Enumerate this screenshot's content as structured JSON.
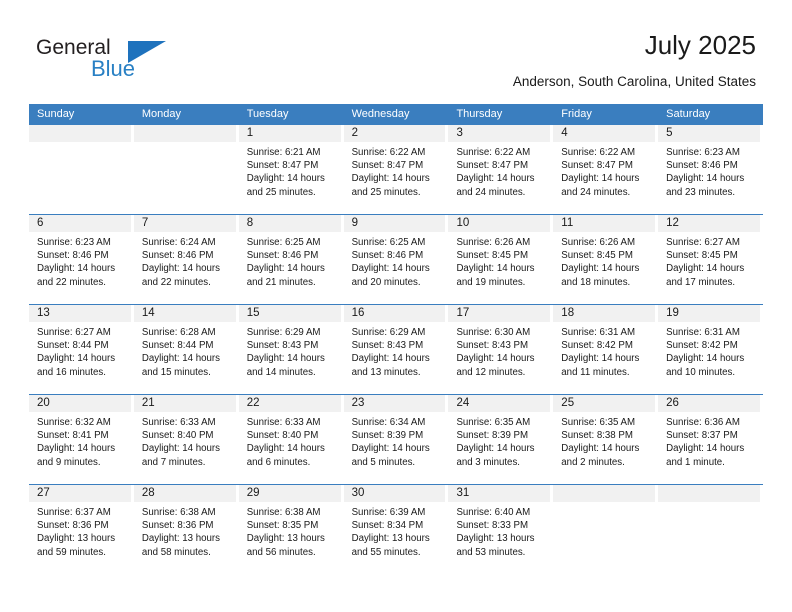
{
  "brand": {
    "name_top": "General",
    "name_bottom": "Blue",
    "triangle_color": "#1e72bd",
    "blue_text_color": "#2980c4"
  },
  "header": {
    "title": "July 2025",
    "location": "Anderson, South Carolina, United States"
  },
  "theme": {
    "header_bg": "#3a7ebf",
    "header_text": "#ffffff",
    "daynum_band": "#f1f1f1",
    "row_divider": "#3a7ebf",
    "body_text": "#1a1a1a"
  },
  "calendar": {
    "weekday_headers": [
      "Sunday",
      "Monday",
      "Tuesday",
      "Wednesday",
      "Thursday",
      "Friday",
      "Saturday"
    ],
    "weeks": [
      [
        {
          "day": ""
        },
        {
          "day": ""
        },
        {
          "day": "1",
          "sunrise": "Sunrise: 6:21 AM",
          "sunset": "Sunset: 8:47 PM",
          "daylight": "Daylight: 14 hours and 25 minutes."
        },
        {
          "day": "2",
          "sunrise": "Sunrise: 6:22 AM",
          "sunset": "Sunset: 8:47 PM",
          "daylight": "Daylight: 14 hours and 25 minutes."
        },
        {
          "day": "3",
          "sunrise": "Sunrise: 6:22 AM",
          "sunset": "Sunset: 8:47 PM",
          "daylight": "Daylight: 14 hours and 24 minutes."
        },
        {
          "day": "4",
          "sunrise": "Sunrise: 6:22 AM",
          "sunset": "Sunset: 8:47 PM",
          "daylight": "Daylight: 14 hours and 24 minutes."
        },
        {
          "day": "5",
          "sunrise": "Sunrise: 6:23 AM",
          "sunset": "Sunset: 8:46 PM",
          "daylight": "Daylight: 14 hours and 23 minutes."
        }
      ],
      [
        {
          "day": "6",
          "sunrise": "Sunrise: 6:23 AM",
          "sunset": "Sunset: 8:46 PM",
          "daylight": "Daylight: 14 hours and 22 minutes."
        },
        {
          "day": "7",
          "sunrise": "Sunrise: 6:24 AM",
          "sunset": "Sunset: 8:46 PM",
          "daylight": "Daylight: 14 hours and 22 minutes."
        },
        {
          "day": "8",
          "sunrise": "Sunrise: 6:25 AM",
          "sunset": "Sunset: 8:46 PM",
          "daylight": "Daylight: 14 hours and 21 minutes."
        },
        {
          "day": "9",
          "sunrise": "Sunrise: 6:25 AM",
          "sunset": "Sunset: 8:46 PM",
          "daylight": "Daylight: 14 hours and 20 minutes."
        },
        {
          "day": "10",
          "sunrise": "Sunrise: 6:26 AM",
          "sunset": "Sunset: 8:45 PM",
          "daylight": "Daylight: 14 hours and 19 minutes."
        },
        {
          "day": "11",
          "sunrise": "Sunrise: 6:26 AM",
          "sunset": "Sunset: 8:45 PM",
          "daylight": "Daylight: 14 hours and 18 minutes."
        },
        {
          "day": "12",
          "sunrise": "Sunrise: 6:27 AM",
          "sunset": "Sunset: 8:45 PM",
          "daylight": "Daylight: 14 hours and 17 minutes."
        }
      ],
      [
        {
          "day": "13",
          "sunrise": "Sunrise: 6:27 AM",
          "sunset": "Sunset: 8:44 PM",
          "daylight": "Daylight: 14 hours and 16 minutes."
        },
        {
          "day": "14",
          "sunrise": "Sunrise: 6:28 AM",
          "sunset": "Sunset: 8:44 PM",
          "daylight": "Daylight: 14 hours and 15 minutes."
        },
        {
          "day": "15",
          "sunrise": "Sunrise: 6:29 AM",
          "sunset": "Sunset: 8:43 PM",
          "daylight": "Daylight: 14 hours and 14 minutes."
        },
        {
          "day": "16",
          "sunrise": "Sunrise: 6:29 AM",
          "sunset": "Sunset: 8:43 PM",
          "daylight": "Daylight: 14 hours and 13 minutes."
        },
        {
          "day": "17",
          "sunrise": "Sunrise: 6:30 AM",
          "sunset": "Sunset: 8:43 PM",
          "daylight": "Daylight: 14 hours and 12 minutes."
        },
        {
          "day": "18",
          "sunrise": "Sunrise: 6:31 AM",
          "sunset": "Sunset: 8:42 PM",
          "daylight": "Daylight: 14 hours and 11 minutes."
        },
        {
          "day": "19",
          "sunrise": "Sunrise: 6:31 AM",
          "sunset": "Sunset: 8:42 PM",
          "daylight": "Daylight: 14 hours and 10 minutes."
        }
      ],
      [
        {
          "day": "20",
          "sunrise": "Sunrise: 6:32 AM",
          "sunset": "Sunset: 8:41 PM",
          "daylight": "Daylight: 14 hours and 9 minutes."
        },
        {
          "day": "21",
          "sunrise": "Sunrise: 6:33 AM",
          "sunset": "Sunset: 8:40 PM",
          "daylight": "Daylight: 14 hours and 7 minutes."
        },
        {
          "day": "22",
          "sunrise": "Sunrise: 6:33 AM",
          "sunset": "Sunset: 8:40 PM",
          "daylight": "Daylight: 14 hours and 6 minutes."
        },
        {
          "day": "23",
          "sunrise": "Sunrise: 6:34 AM",
          "sunset": "Sunset: 8:39 PM",
          "daylight": "Daylight: 14 hours and 5 minutes."
        },
        {
          "day": "24",
          "sunrise": "Sunrise: 6:35 AM",
          "sunset": "Sunset: 8:39 PM",
          "daylight": "Daylight: 14 hours and 3 minutes."
        },
        {
          "day": "25",
          "sunrise": "Sunrise: 6:35 AM",
          "sunset": "Sunset: 8:38 PM",
          "daylight": "Daylight: 14 hours and 2 minutes."
        },
        {
          "day": "26",
          "sunrise": "Sunrise: 6:36 AM",
          "sunset": "Sunset: 8:37 PM",
          "daylight": "Daylight: 14 hours and 1 minute."
        }
      ],
      [
        {
          "day": "27",
          "sunrise": "Sunrise: 6:37 AM",
          "sunset": "Sunset: 8:36 PM",
          "daylight": "Daylight: 13 hours and 59 minutes."
        },
        {
          "day": "28",
          "sunrise": "Sunrise: 6:38 AM",
          "sunset": "Sunset: 8:36 PM",
          "daylight": "Daylight: 13 hours and 58 minutes."
        },
        {
          "day": "29",
          "sunrise": "Sunrise: 6:38 AM",
          "sunset": "Sunset: 8:35 PM",
          "daylight": "Daylight: 13 hours and 56 minutes."
        },
        {
          "day": "30",
          "sunrise": "Sunrise: 6:39 AM",
          "sunset": "Sunset: 8:34 PM",
          "daylight": "Daylight: 13 hours and 55 minutes."
        },
        {
          "day": "31",
          "sunrise": "Sunrise: 6:40 AM",
          "sunset": "Sunset: 8:33 PM",
          "daylight": "Daylight: 13 hours and 53 minutes."
        },
        {
          "day": ""
        },
        {
          "day": ""
        }
      ]
    ]
  }
}
